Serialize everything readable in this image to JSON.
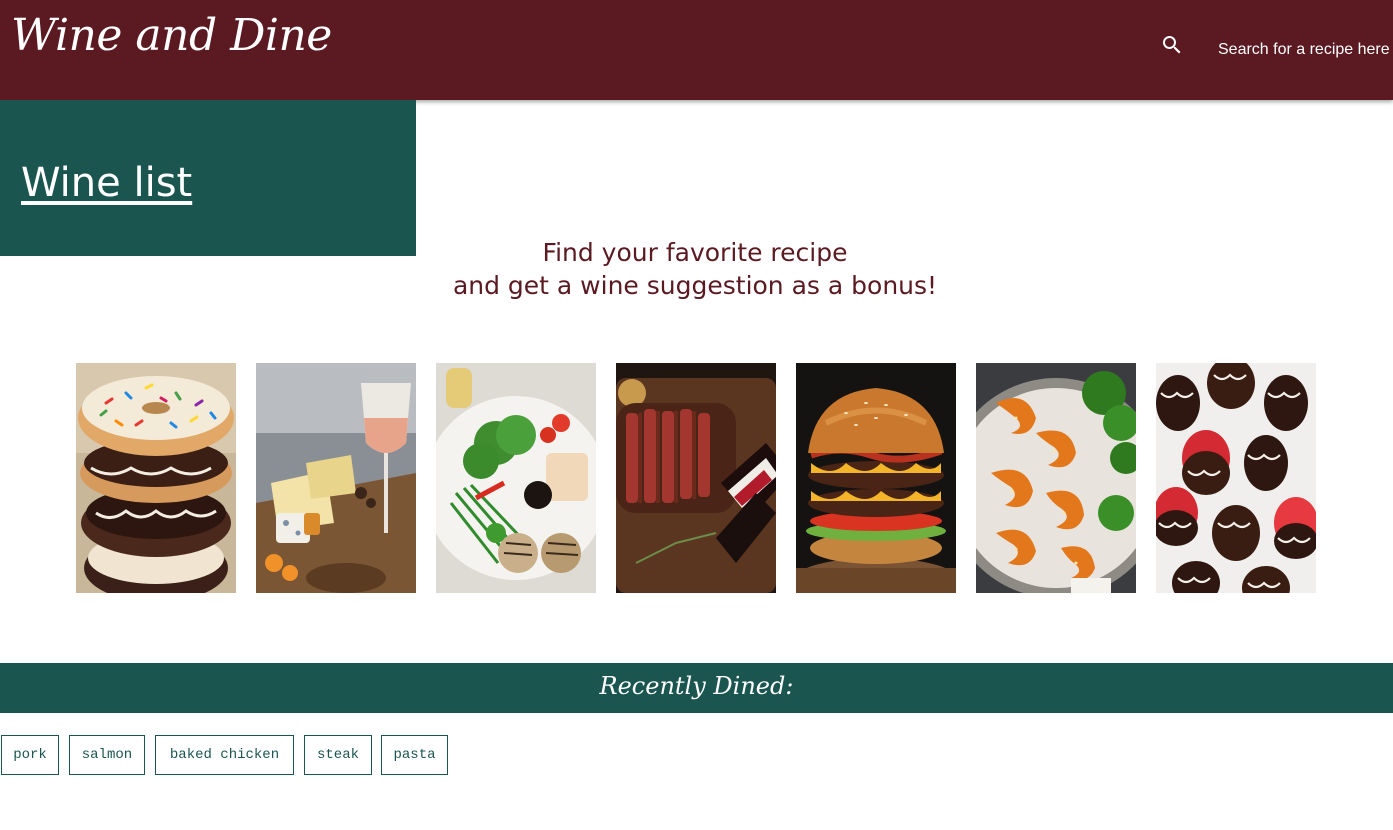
{
  "header": {
    "brand": "Wine and Dine",
    "search_placeholder": "Search for a recipe here"
  },
  "sidebar": {
    "link_label": "Wine list"
  },
  "tagline": {
    "line1": "Find your favorite recipe",
    "line2": "and get a wine suggestion as a bonus!"
  },
  "gallery": [
    {
      "subject": "donuts"
    },
    {
      "subject": "cheese-board-wine"
    },
    {
      "subject": "grilled-vegetables"
    },
    {
      "subject": "steak-red-wine"
    },
    {
      "subject": "burger"
    },
    {
      "subject": "shrimp-broccoli"
    },
    {
      "subject": "chocolate-strawberries"
    }
  ],
  "recent": {
    "title": "Recently Dined:",
    "items": [
      "pork",
      "salmon",
      "baked chicken",
      "steak",
      "pasta"
    ]
  },
  "colors": {
    "header_bg": "#5b1a22",
    "accent_green": "#1b5550",
    "text_white": "#ffffff"
  }
}
